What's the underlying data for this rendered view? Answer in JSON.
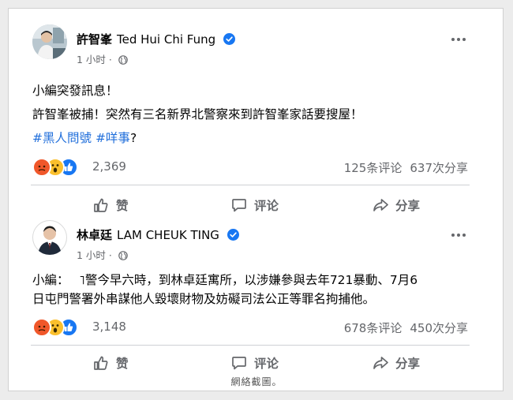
{
  "posts": [
    {
      "author_zh": "許智峯",
      "author_en": "Ted Hui Chi Fung",
      "time": "1 小时 ·",
      "lines": [
        "小編突發訊息！",
        "許智峯被捕！突然有三名新界北警察來到許智峯家話要搜屋！"
      ],
      "hashtags": [
        "#黑人問號",
        "#咩事"
      ],
      "hashtag_suffix": "?",
      "reaction_count": "2,369",
      "comments": "125条评论",
      "shares": "637次分享",
      "actions": {
        "like": "赞",
        "comment": "评论",
        "share": "分享"
      }
    },
    {
      "author_zh": "林卓廷",
      "author_en": "LAM CHEUK TING",
      "time": "1 小时 ·",
      "lines": [
        "小編：　 ˥警今早六時，到林卓廷寓所，以涉嫌參與去年721暴動、7月6",
        "日屯門警署外串謀他人毀壞財物及妨礙司法公正等罪名拘捕他。"
      ],
      "reaction_count": "3,148",
      "comments": "678条评论",
      "shares": "450次分享",
      "actions": {
        "like": "赞",
        "comment": "评论",
        "share": "分享"
      }
    }
  ],
  "caption": "網絡截圖。",
  "colors": {
    "hashtag": "#216fdb",
    "verified": "#1877f2",
    "meta": "#65676b",
    "angry": "#f0572a",
    "wow": "#fbc02d",
    "like": "#1877f2"
  },
  "icons": [
    "verified-badge-icon",
    "globe-icon",
    "more-options-icon",
    "angry-reaction-icon",
    "wow-reaction-icon",
    "like-reaction-icon",
    "thumbs-up-icon",
    "comment-bubble-icon",
    "share-arrow-icon"
  ]
}
